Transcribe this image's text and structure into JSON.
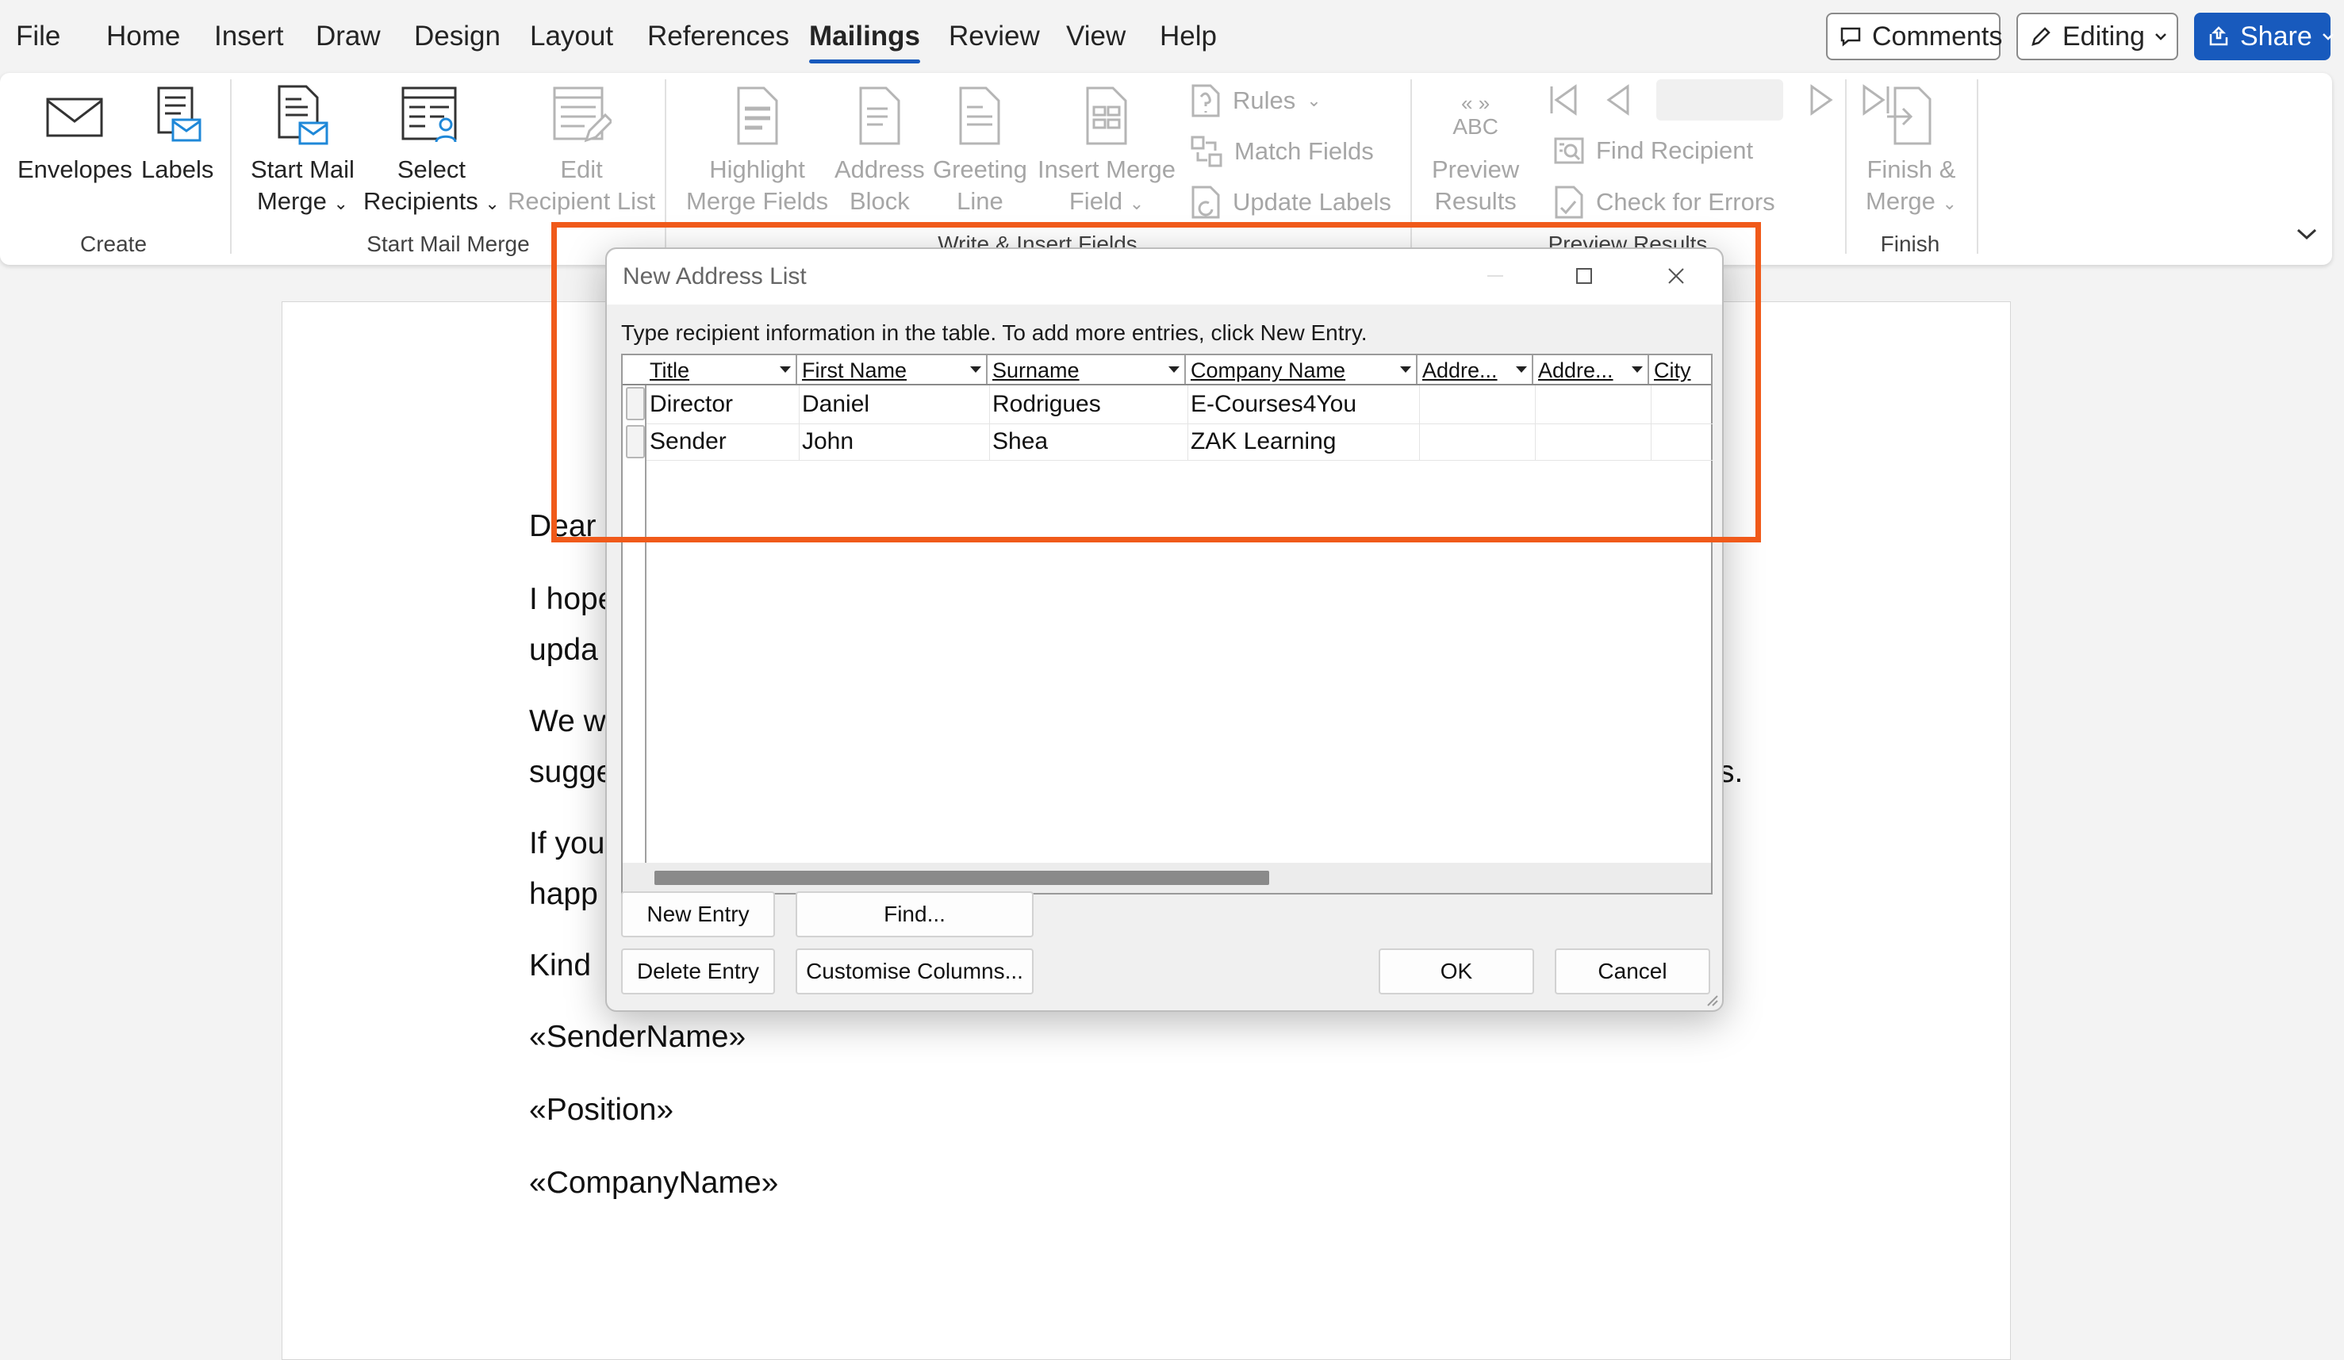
{
  "menu": {
    "tabs": [
      "File",
      "Home",
      "Insert",
      "Draw",
      "Design",
      "Layout",
      "References",
      "Mailings",
      "Review",
      "View",
      "Help"
    ],
    "active_tab": "Mailings",
    "comments_label": "Comments",
    "editing_label": "Editing",
    "share_label": "Share"
  },
  "ribbon": {
    "create": {
      "envelopes": "Envelopes",
      "labels": "Labels",
      "group_label": "Create"
    },
    "start_mail_merge": {
      "start_mail_merge_l1": "Start Mail",
      "start_mail_merge_l2": "Merge",
      "select_recipients_l1": "Select",
      "select_recipients_l2": "Recipients",
      "edit_recipient_list_l1": "Edit",
      "edit_recipient_list_l2": "Recipient List",
      "group_label": "Start Mail Merge"
    },
    "write_insert": {
      "highlight_l1": "Highlight",
      "highlight_l2": "Merge Fields",
      "address_l1": "Address",
      "address_l2": "Block",
      "greeting_l1": "Greeting",
      "greeting_l2": "Line",
      "insert_field_l1": "Insert Merge",
      "insert_field_l2": "Field",
      "rules": "Rules",
      "match_fields": "Match Fields",
      "update_labels": "Update Labels",
      "group_label": "Write & Insert Fields"
    },
    "preview": {
      "abc": "ABC",
      "preview_l1": "Preview",
      "preview_l2": "Results",
      "find_recipient": "Find Recipient",
      "check_errors": "Check for Errors",
      "group_label": "Preview Results"
    },
    "finish": {
      "finish_l1": "Finish &",
      "finish_l2": "Merge",
      "group_label": "Finish"
    }
  },
  "document": {
    "lines": [
      "Dear",
      "I hope",
      "upda",
      "We w",
      "sugge",
      "s.",
      "If you",
      "happ",
      "Kind",
      "«SenderName»",
      "«Position»",
      "«CompanyName»"
    ]
  },
  "dialog": {
    "title": "New Address List",
    "instruction": "Type recipient information in the table.  To add more entries, click New Entry.",
    "columns": [
      "Title",
      "First Name",
      "Surname",
      "Company Name",
      "Addre...",
      "Addre...",
      "City"
    ],
    "rows": [
      [
        "Director",
        "Daniel",
        "Rodrigues",
        "E-Courses4You"
      ],
      [
        "Sender",
        "John",
        "Shea",
        "ZAK Learning"
      ]
    ],
    "buttons": {
      "new_entry": "New Entry",
      "find": "Find...",
      "delete_entry": "Delete Entry",
      "customise_columns": "Customise Columns...",
      "ok": "OK",
      "cancel": "Cancel"
    }
  },
  "colors": {
    "accent": "#185abd",
    "highlight": "#f05a1a"
  }
}
